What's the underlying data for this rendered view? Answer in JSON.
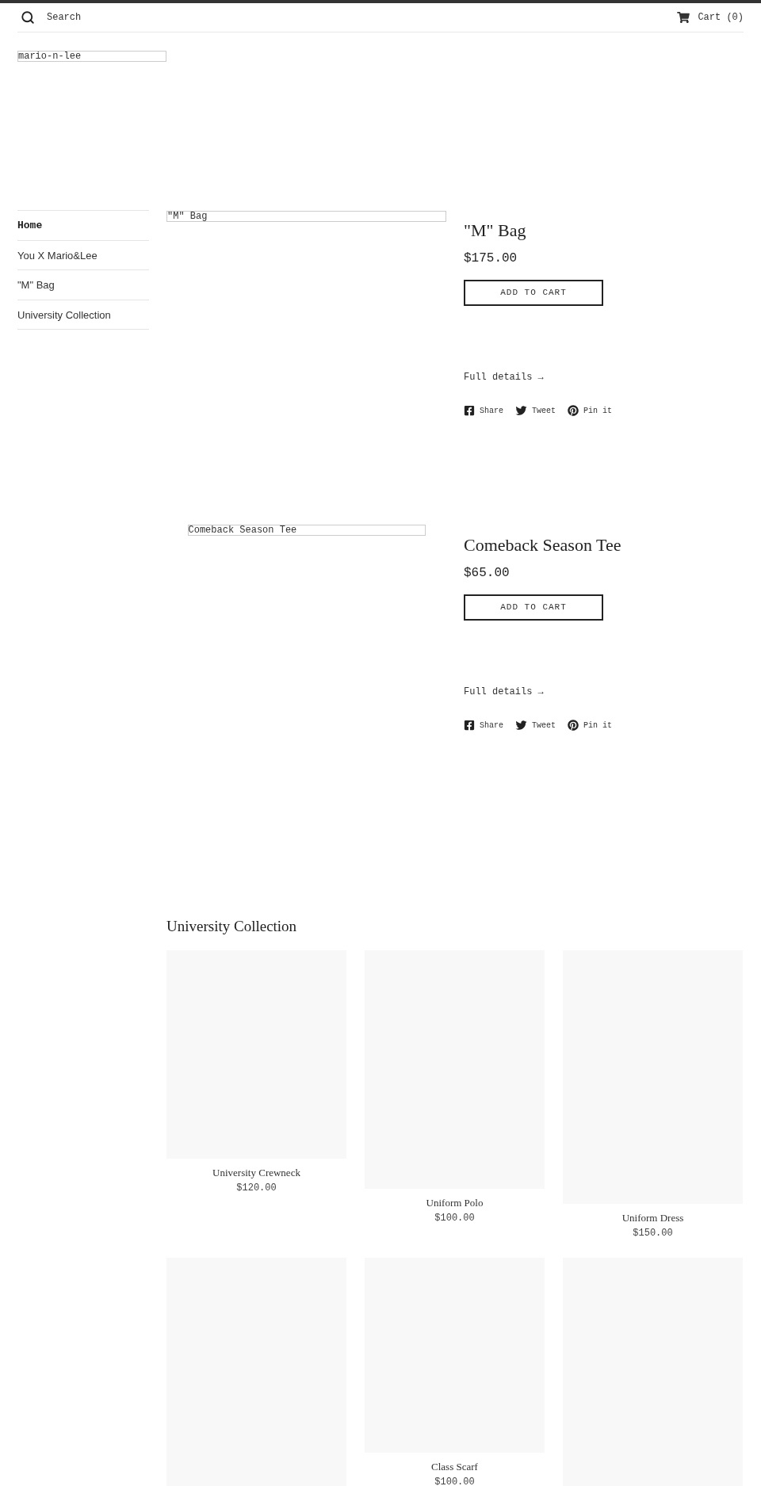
{
  "header": {
    "search": {
      "placeholder": "Search"
    },
    "cart": "Cart (0)"
  },
  "logo_alt": "mario-n-lee",
  "sidebar": {
    "items": [
      {
        "label": "Home",
        "selected": true
      },
      {
        "label": "You X Mario&Lee",
        "selected": false
      },
      {
        "label": "\"M\" Bag",
        "selected": false
      },
      {
        "label": "University Collection",
        "selected": false
      }
    ]
  },
  "products": [
    {
      "image_alt": "\"M\" Bag",
      "title": "\"M\" Bag",
      "price": "$175.00",
      "button": "ADD TO CART",
      "details_link": "Full details →",
      "share": [
        {
          "kind": "facebook",
          "label": "Share"
        },
        {
          "kind": "twitter",
          "label": "Tweet"
        },
        {
          "kind": "pinterest",
          "label": "Pin it"
        }
      ]
    },
    {
      "image_alt": "Comeback Season Tee",
      "title": "Comeback Season Tee",
      "price": "$65.00",
      "button": "ADD TO CART",
      "details_link": "Full details →",
      "share": [
        {
          "kind": "facebook",
          "label": "Share"
        },
        {
          "kind": "twitter",
          "label": "Tweet"
        },
        {
          "kind": "pinterest",
          "label": "Pin it"
        }
      ]
    }
  ],
  "collection": {
    "title": "University Collection",
    "items": [
      {
        "kind": "card",
        "name": "University Crewneck",
        "price": "$120.00"
      },
      {
        "kind": "card",
        "name": "Uniform Polo",
        "price": "$100.00"
      },
      {
        "kind": "card",
        "name": "Uniform Dress",
        "price": "$150.00"
      },
      {
        "kind": "image"
      },
      {
        "kind": "card",
        "name": "Class Scarf",
        "price": "$100.00"
      },
      {
        "kind": "image"
      }
    ]
  }
}
